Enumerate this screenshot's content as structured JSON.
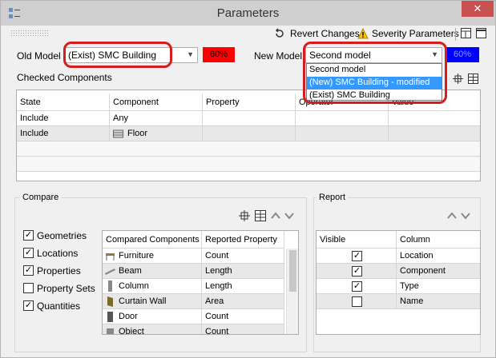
{
  "window": {
    "title": "Parameters",
    "close_glyph": "✕"
  },
  "toolbar": {
    "revert_label": "Revert Changes",
    "severity_label": "Severity Parameters"
  },
  "old_model": {
    "label": "Old Model",
    "value": "(Exist) SMC Building",
    "percent": "60%",
    "percent_color": "#ff0000"
  },
  "new_model": {
    "label": "New Model",
    "value": "Second model",
    "percent": "60%",
    "percent_color": "#0000ff",
    "options": [
      "Second model",
      "(New) SMC Building - modified",
      "(Exist) SMC Building"
    ],
    "highlighted_index": 1
  },
  "checked": {
    "title": "Checked Components",
    "columns": [
      "State",
      "Component",
      "Property",
      "Operator",
      "Value"
    ],
    "rows": [
      {
        "state": "Include",
        "component": "Any"
      },
      {
        "state": "Include",
        "component": "Floor"
      }
    ]
  },
  "compare": {
    "title": "Compare",
    "options": [
      {
        "label": "Geometries",
        "checked": true
      },
      {
        "label": "Locations",
        "checked": true
      },
      {
        "label": "Properties",
        "checked": true
      },
      {
        "label": "Property Sets",
        "checked": false
      },
      {
        "label": "Quantities",
        "checked": true
      }
    ],
    "columns": [
      "Compared Components",
      "Reported Property"
    ],
    "rows": [
      {
        "component": "Furniture",
        "property": "Count"
      },
      {
        "component": "Beam",
        "property": "Length"
      },
      {
        "component": "Column",
        "property": "Length"
      },
      {
        "component": "Curtain Wall",
        "property": "Area"
      },
      {
        "component": "Door",
        "property": "Count"
      },
      {
        "component": "Object",
        "property": "Count"
      }
    ]
  },
  "report": {
    "title": "Report",
    "columns": [
      "Visible",
      "Column"
    ],
    "rows": [
      {
        "visible": true,
        "column": "Location"
      },
      {
        "visible": true,
        "column": "Component"
      },
      {
        "visible": true,
        "column": "Type"
      },
      {
        "visible": false,
        "column": "Name"
      }
    ]
  },
  "colors": {
    "highlight": "#3399ff",
    "annotation_ring": "#d61c1c",
    "titlebar": "#cfcfcf"
  }
}
